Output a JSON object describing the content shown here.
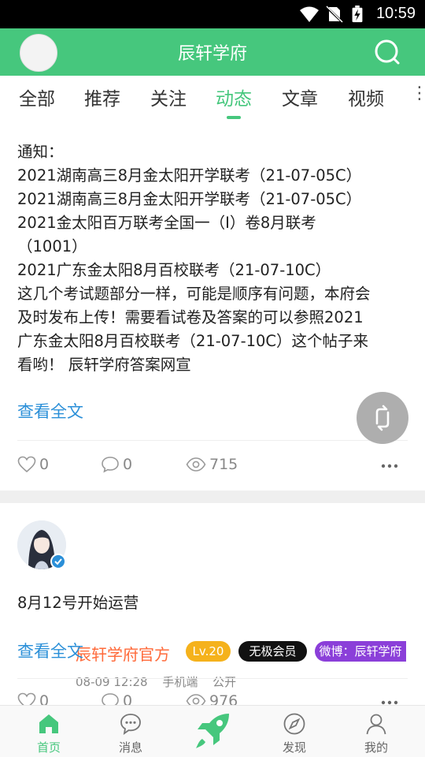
{
  "status_bar": {
    "time": "10:59"
  },
  "app_bar": {
    "title": "辰轩学府"
  },
  "tabs": [
    {
      "label": "全部"
    },
    {
      "label": "推荐"
    },
    {
      "label": "关注"
    },
    {
      "label": "动态",
      "active": true
    },
    {
      "label": "文章"
    },
    {
      "label": "视频"
    }
  ],
  "tabs_more": "⋮",
  "post1": {
    "lines": [
      "通知：",
      "2021湖南高三8月金太阳开学联考（21-07-05C）",
      "2021湖南高三8月金太阳开学联考（21-07-05C）",
      "2021金太阳百万联考全国一（I）卷8月联考",
      "（1001）",
      "2021广东金太阳8月百校联考（21-07-10C）",
      "这几个考试题部分一样，可能是顺序有问题，本府会",
      "及时发布上传！需要看试卷及答案的可以参照2021",
      "广东金太阳8月百校联考（21-07-10C）这个帖子来",
      "看哟！ 辰轩学府答案网宣"
    ],
    "read_more": "查看全文",
    "likes": "0",
    "comments": "0",
    "views": "715"
  },
  "post2": {
    "author": "辰轩学府官方",
    "level": "Lv.20",
    "member_badge": "无极会员",
    "weibo_badge": "微博：辰轩学府",
    "date": "08-09 12:28",
    "device": "手机端",
    "visibility": "公开",
    "text": "8月12号开始运营",
    "read_more": "查看全文",
    "likes": "0",
    "comments": "0",
    "views": "976"
  },
  "bottom_nav": [
    {
      "label": "首页",
      "icon": "home-icon",
      "active": true
    },
    {
      "label": "消息",
      "icon": "message-icon"
    },
    {
      "label": "",
      "icon": "rocket-icon"
    },
    {
      "label": "发现",
      "icon": "compass-icon"
    },
    {
      "label": "我的",
      "icon": "user-icon"
    }
  ],
  "colors": {
    "brand_green": "#46c77d",
    "link_blue": "#2a8fd8",
    "username_orange": "#ff6a3a",
    "level_badge": "#f5b21c",
    "weibo_badge": "#8b3fd9"
  }
}
